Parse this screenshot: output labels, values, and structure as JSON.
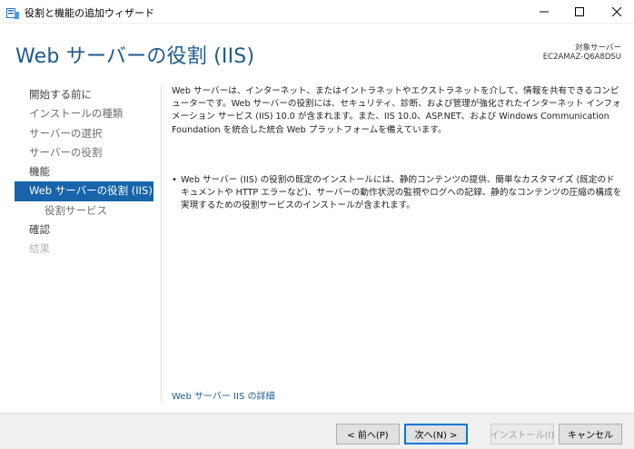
{
  "window": {
    "title": "役割と機能の追加ウィザード"
  },
  "header": {
    "page_title": "Web サーバーの役割 (IIS)",
    "destination_label": "対象サーバー",
    "destination_server": "EC2AMAZ-Q6A8DSU"
  },
  "nav": {
    "items": [
      {
        "label": "開始する前に",
        "state": "done"
      },
      {
        "label": "インストールの種類",
        "state": "normal"
      },
      {
        "label": "サーバーの選択",
        "state": "normal"
      },
      {
        "label": "サーバーの役割",
        "state": "normal"
      },
      {
        "label": "機能",
        "state": "done"
      },
      {
        "label": "Web サーバーの役割 (IIS)",
        "state": "active"
      },
      {
        "label": "役割サービス",
        "state": "sub"
      },
      {
        "label": "確認",
        "state": "done"
      },
      {
        "label": "結果",
        "state": "disabled"
      }
    ]
  },
  "content": {
    "intro": "Web サーバーは、インターネット、またはイントラネットやエクストラネットを介して、情報を共有できるコンピューターです。Web サーバーの役割には、セキュリティ、診断、および管理が強化されたインターネット インフォメーション サービス (IIS) 10.0 が含まれます。また、IIS 10.0、ASP.NET、および Windows Communication Foundation を統合した統合 Web プラットフォームを備えています。",
    "bullet": "Web サーバー (IIS) の役割の既定のインストールには、静的コンテンツの提供、簡単なカスタマイズ (既定のドキュメントや HTTP エラーなど)、サーバーの動作状況の監視やログへの記録、静的なコンテンツの圧縮の構成を実現するための役割サービスのインストールが含まれます。",
    "more_link": "Web サーバー IIS の詳細"
  },
  "footer": {
    "prev_label": "< 前へ(P)",
    "next_label": "次へ(N) >",
    "install_label": "インストール(I)",
    "cancel_label": "キャンセル"
  },
  "colors": {
    "accent": "#1864ab",
    "title_blue": "#1d5b8a",
    "link": "#1f5c95"
  },
  "icons": {
    "app": "server-manager-icon",
    "minimize": "minimize-icon",
    "maximize": "maximize-icon",
    "close": "close-icon"
  }
}
